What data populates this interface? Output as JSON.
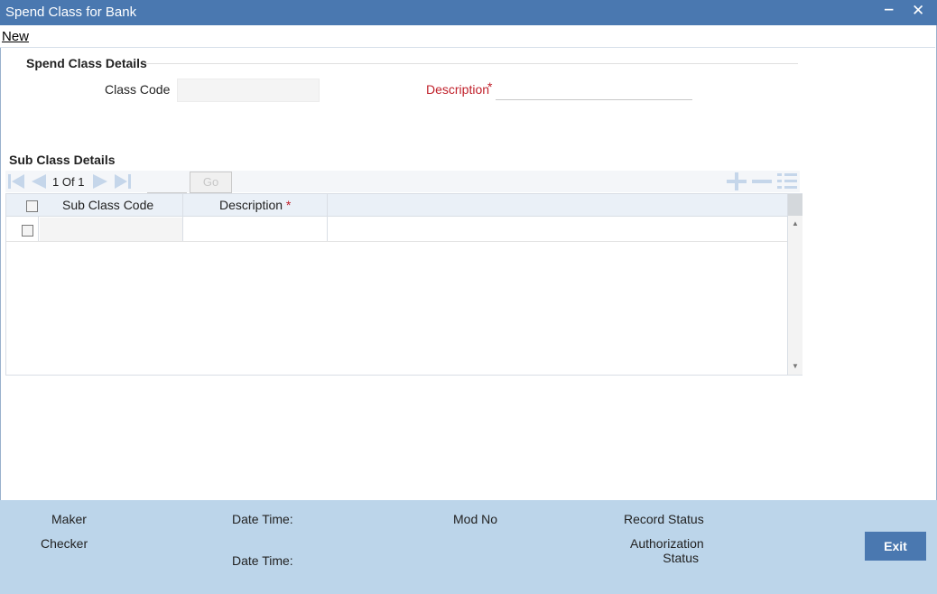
{
  "window": {
    "title": "Spend Class for Bank",
    "minimize": "‒",
    "close": "✕"
  },
  "menu": {
    "new_label": "New"
  },
  "spend_class": {
    "section_title": "Spend Class Details",
    "class_code_label": "Class Code",
    "class_code_value": "",
    "description_label": "Description",
    "required_mark": "*",
    "description_value": ""
  },
  "sub_class": {
    "section_title": "Sub Class Details",
    "pager": {
      "current": "1",
      "of_label": "Of",
      "total": "1"
    },
    "go_label": "Go",
    "columns": [
      {
        "label": "Sub Class Code",
        "required": ""
      },
      {
        "label": "Description",
        "required": "*"
      }
    ],
    "rows": [
      {
        "sub_class_code": "",
        "description": ""
      }
    ]
  },
  "footer": {
    "maker_label": "Maker",
    "checker_label": "Checker",
    "date_time_label_1": "Date Time:",
    "date_time_label_2": "Date Time:",
    "mod_no_label": "Mod No",
    "record_status_label": "Record Status",
    "authorization_label_line1": "Authorization",
    "authorization_label_line2": "Status",
    "exit_label": "Exit"
  },
  "colors": {
    "title_bar": "#4a78b0",
    "footer": "#bcd5ea",
    "required": "#c0202a",
    "nav_icon": "#c5d6ea"
  }
}
